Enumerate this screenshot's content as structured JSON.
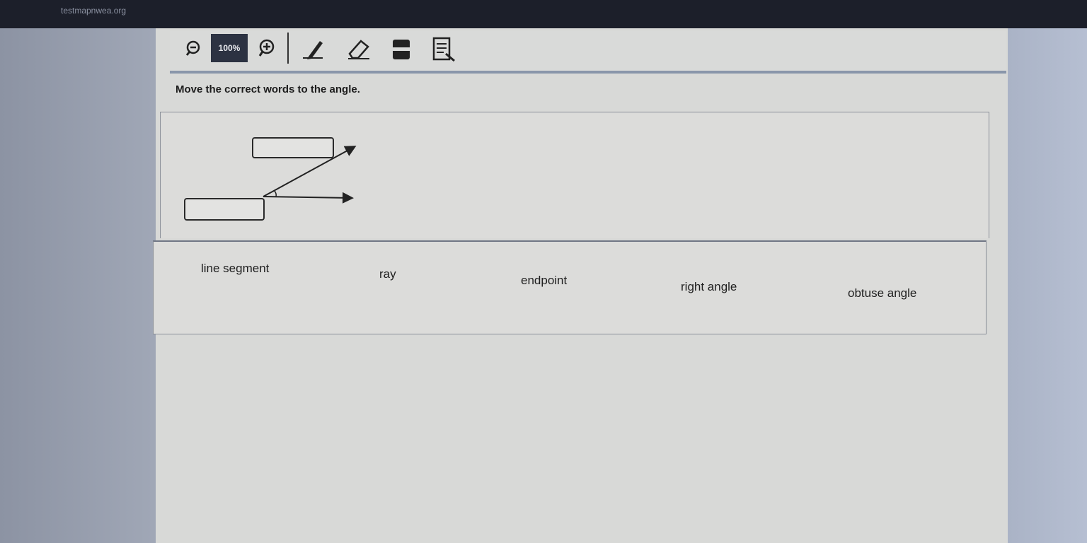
{
  "browser": {
    "url": "testmapnwea.org"
  },
  "toolbar": {
    "zoom_level": "100%",
    "icons": [
      "zoom-out-icon",
      "zoom-in-icon",
      "pencil-icon",
      "eraser-icon",
      "highlighter-icon",
      "line-reader-icon"
    ]
  },
  "question": {
    "prompt": "Move the correct words to the angle."
  },
  "word_bank": {
    "words": [
      "line segment",
      "ray",
      "endpoint",
      "right angle",
      "obtuse angle"
    ]
  }
}
